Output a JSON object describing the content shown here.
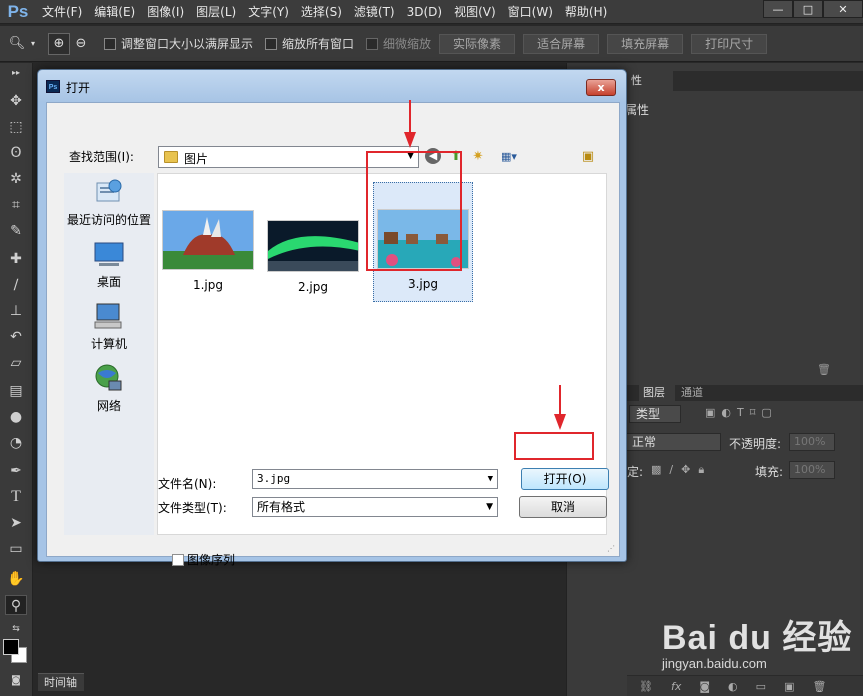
{
  "app": {
    "logo": "Ps"
  },
  "menu": [
    "文件(F)",
    "编辑(E)",
    "图像(I)",
    "图层(L)",
    "文字(Y)",
    "选择(S)",
    "滤镜(T)",
    "3D(D)",
    "视图(V)",
    "窗口(W)",
    "帮助(H)"
  ],
  "window_controls": {
    "minimize": "—",
    "restore": "□",
    "close": "✕"
  },
  "options_bar": {
    "resize_windows": "调整窗口大小以满屏显示",
    "zoom_all": "缩放所有窗口",
    "scrubby_zoom": "细微缩放",
    "actual_pixels": "实际像素",
    "fit_screen": "适合屏幕",
    "fill_screen": "填充屏幕",
    "print_size": "打印尺寸"
  },
  "panels": {
    "properties_tab": "性",
    "properties_title": "属性",
    "layers_tab": "图层",
    "channels_tab": "通道",
    "kind_select": "类型",
    "blend_mode": "正常",
    "opacity_label": "不透明度:",
    "opacity_value": "100%",
    "lock_label": "定:",
    "fill_label": "填充:",
    "fill_value": "100%",
    "bottom_fx": "fx"
  },
  "timeline_tab": "时间轴",
  "dialog": {
    "title": "打开",
    "ps_icon": "Ps",
    "close": "x",
    "look_in_label": "查找范围(I):",
    "look_in_value": "图片",
    "places": [
      {
        "label": "最近访问的位置",
        "icon": "recent-places-icon"
      },
      {
        "label": "桌面",
        "icon": "desktop-icon"
      },
      {
        "label": "计算机",
        "icon": "computer-icon"
      },
      {
        "label": "网络",
        "icon": "network-icon"
      }
    ],
    "files": [
      {
        "name": "1.jpg",
        "selected": false
      },
      {
        "name": "2.jpg",
        "selected": false
      },
      {
        "name": "3.jpg",
        "selected": true
      }
    ],
    "filename_label": "文件名(N):",
    "filename_value": "3.jpg",
    "filetype_label": "文件类型(T):",
    "filetype_value": "所有格式",
    "open_button": "打开(O)",
    "cancel_button": "取消",
    "image_sequence": "图像序列"
  },
  "watermark": {
    "brand": "Bai du 经验",
    "url": "jingyan.baidu.com"
  },
  "colors": {
    "annotation_red": "#e0262c",
    "dialog_frame": "#a6c4e6",
    "ps_dark": "#3a3a3a"
  }
}
